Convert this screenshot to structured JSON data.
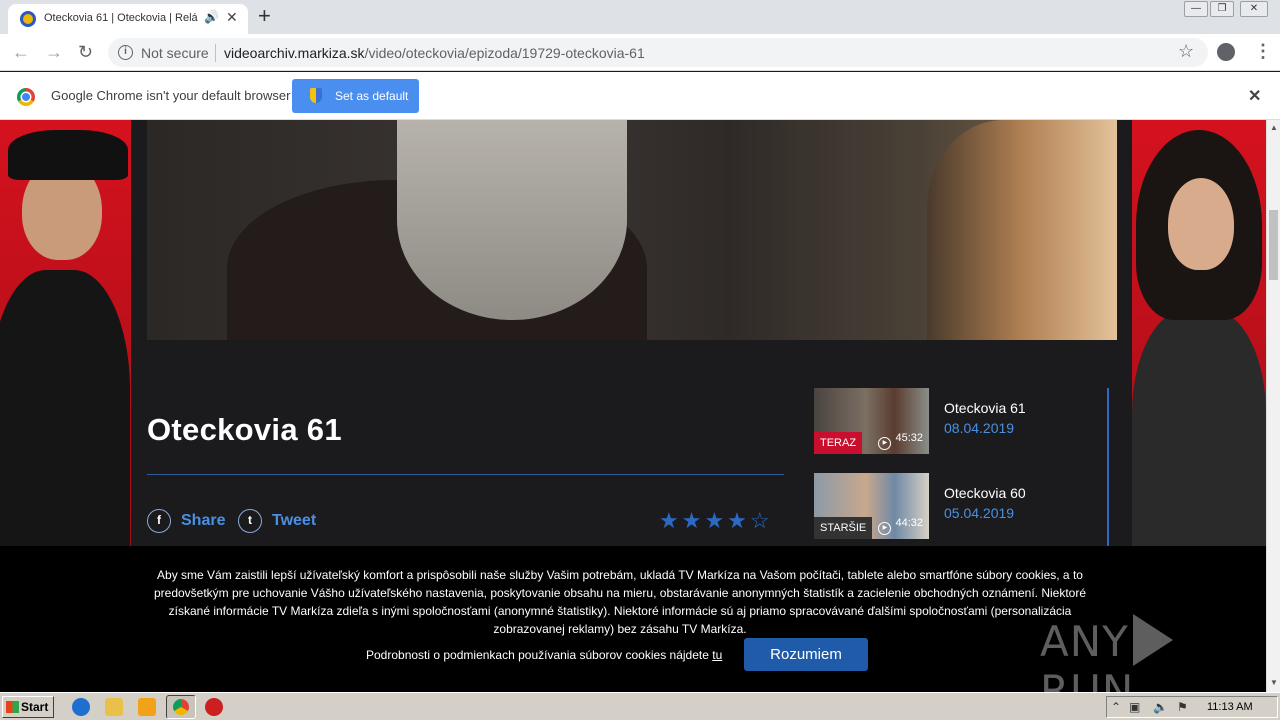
{
  "browser": {
    "tab_title": "Oteckovia 61 | Oteckovia | Relá",
    "url_host": "videoarchiv.markiza.sk",
    "url_path": "/video/oteckovia/epizoda/19729-oteckovia-61",
    "security_label": "Not secure",
    "new_tab_label": "+",
    "nav": {
      "back": "←",
      "forward": "→",
      "reload": "↻"
    },
    "window_controls": {
      "minimize": "—",
      "maximize": "❐",
      "close": "✕"
    }
  },
  "infobar": {
    "message": "Google Chrome isn't your default browser",
    "button_label": "Set as default",
    "close_label": "✕"
  },
  "episode": {
    "title": "Oteckovia 61",
    "share_label": "Share",
    "tweet_label": "Tweet",
    "facebook_glyph": "f",
    "twitter_glyph": "t",
    "rating_filled": "★★★★",
    "rating_empty": "☆",
    "rating_value": 4,
    "rating_max": 5
  },
  "episode_list": [
    {
      "badge": "TERAZ",
      "badge_color": "#c8102e",
      "duration": "45:32",
      "name": "Oteckovia 61",
      "date": "08.04.2019"
    },
    {
      "badge": "STARŠIE",
      "badge_color": "#333333",
      "duration": "44:32",
      "name": "Oteckovia 60",
      "date": "05.04.2019"
    }
  ],
  "cookie": {
    "text": "Aby sme Vám zaistili lepší užívateľský komfort a prispôsobili naše služby Vašim potrebám, ukladá TV Markíza na Vašom počítači, tablete alebo smartfóne súbory cookies, a to predovšetkým pre uchovanie Vášho užívateľského nastavenia, poskytovanie obsahu na mieru, obstarávanie anonymných štatistík a zacielenie obchodných oznámení. Niektoré získané informácie TV Markíza zdieľa s inými spoločnosťami (anonymné štatistiky). Niektoré informácie sú aj priamo spracovávané ďalšími spoločnosťami (personalizácia zobrazovanej reklamy) bez zásahu TV Markíza.",
    "more_text": "Podrobnosti o podmienkach používania súborov cookies nájdete ",
    "more_link": "tu",
    "accept_label": "Rozumiem"
  },
  "watermark": {
    "left": "ANY",
    "right": "RUN"
  },
  "taskbar": {
    "start_label": "Start",
    "clock": "11:13 AM"
  },
  "colors": {
    "accent_blue": "#4a90e2",
    "teraz_red": "#c8102e",
    "ad_red": "#d4121e"
  }
}
